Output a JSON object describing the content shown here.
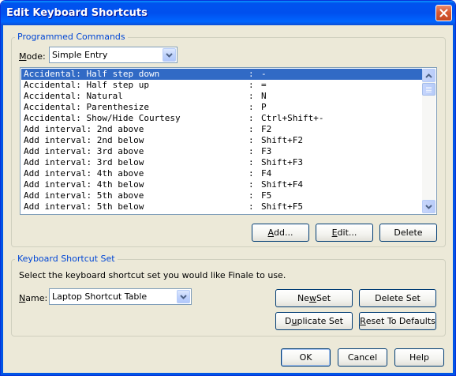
{
  "window": {
    "title": "Edit Keyboard Shortcuts"
  },
  "programmed": {
    "legend": "Programmed Commands",
    "mode_label_mnemonic": "M",
    "mode_label_rest": "ode:",
    "mode_value": "Simple Entry",
    "rows": [
      {
        "command": "Accidental: Half step down",
        "sep": ":",
        "key": "-",
        "selected": true
      },
      {
        "command": "Accidental: Half step up",
        "sep": ":",
        "key": "="
      },
      {
        "command": "Accidental: Natural",
        "sep": ":",
        "key": "N"
      },
      {
        "command": "Accidental: Parenthesize",
        "sep": ":",
        "key": "P"
      },
      {
        "command": "Accidental: Show/Hide Courtesy",
        "sep": ":",
        "key": "Ctrl+Shift+-"
      },
      {
        "command": "Add interval: 2nd above",
        "sep": ":",
        "key": "F2"
      },
      {
        "command": "Add interval: 2nd below",
        "sep": ":",
        "key": "Shift+F2"
      },
      {
        "command": "Add interval: 3rd above",
        "sep": ":",
        "key": "F3"
      },
      {
        "command": "Add interval: 3rd below",
        "sep": ":",
        "key": "Shift+F3"
      },
      {
        "command": "Add interval: 4th above",
        "sep": ":",
        "key": "F4"
      },
      {
        "command": "Add interval: 4th below",
        "sep": ":",
        "key": "Shift+F4"
      },
      {
        "command": "Add interval: 5th above",
        "sep": ":",
        "key": "F5"
      },
      {
        "command": "Add interval: 5th below",
        "sep": ":",
        "key": "Shift+F5"
      }
    ],
    "add_mnemonic": "A",
    "add_rest": "dd...",
    "edit_mnemonic": "E",
    "edit_rest": "dit...",
    "delete_label": "Delete"
  },
  "shortcut_set": {
    "legend": "Keyboard Shortcut Set",
    "instruction": "Select the keyboard shortcut set you would like Finale to use.",
    "name_label_mnemonic": "N",
    "name_label_rest": "ame:",
    "name_value": "Laptop Shortcut Table",
    "new_set_pre": "Ne",
    "new_set_mnemonic": "w",
    "new_set_post": " Set",
    "delete_set_label": "Delete Set",
    "duplicate_pre": "D",
    "duplicate_mnemonic": "u",
    "duplicate_post": "plicate Set",
    "reset_pre": "",
    "reset_mnemonic": "R",
    "reset_post": "eset To Defaults"
  },
  "footer": {
    "ok_label": "OK",
    "cancel_label": "Cancel",
    "help_label": "Help"
  },
  "colors": {
    "titlebar": "#0053ee",
    "accent_text": "#0046d5",
    "selection": "#316ac5",
    "dialog_bg": "#ece9d8"
  },
  "icons": {
    "close": "close-icon",
    "dropdown": "chevron-down-icon",
    "scroll_up": "arrow-up-icon",
    "scroll_down": "arrow-down-icon"
  }
}
